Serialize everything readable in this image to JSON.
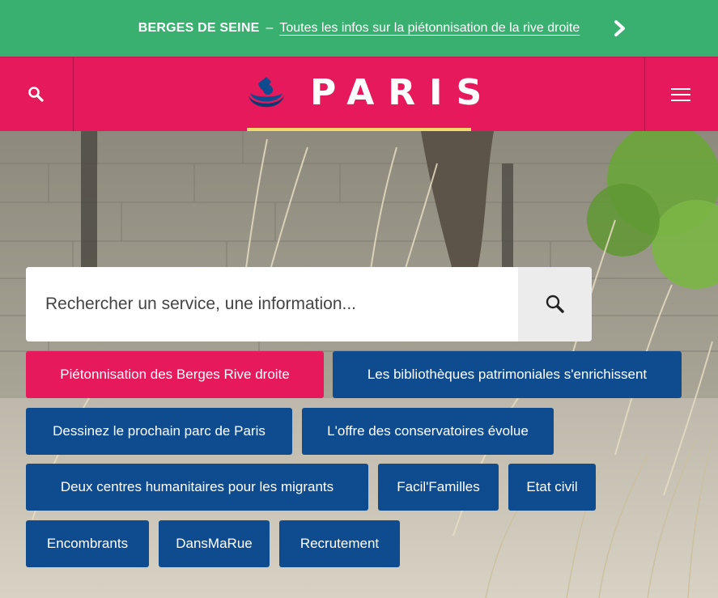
{
  "banner": {
    "title": "BERGES DE SEINE",
    "separator": "–",
    "link_text": "Toutes les infos sur la piétonnisation de la rive droite",
    "chevron_icon": "chevron-right-icon",
    "bg_color": "#3ab070"
  },
  "header": {
    "logo_text": "PARIS",
    "search_icon": "search-icon",
    "menu_icon": "hamburger-menu-icon",
    "bg_color": "#e5195b",
    "underline_color": "#f4d96a"
  },
  "search": {
    "placeholder": "Rechercher un service, une information...",
    "button_icon": "search-icon"
  },
  "quick_links": [
    {
      "label": "Piétonnisation des Berges Rive droite",
      "highlighted": true
    },
    {
      "label": "Les bibliothèques patrimoniales s'enrichissent",
      "highlighted": false
    },
    {
      "label": "Dessinez le prochain parc de Paris",
      "highlighted": false
    },
    {
      "label": "L'offre des conservatoires évolue",
      "highlighted": false
    },
    {
      "label": "Deux centres humanitaires pour les migrants",
      "highlighted": false
    },
    {
      "label": "Facil'Familles",
      "highlighted": false
    },
    {
      "label": "Etat civil",
      "highlighted": false
    },
    {
      "label": "Encombrants",
      "highlighted": false
    },
    {
      "label": "DansMaRue",
      "highlighted": false
    },
    {
      "label": "Recrutement",
      "highlighted": false
    }
  ],
  "colors": {
    "tag_blue": "#0f4c8f",
    "tag_pink": "#e5195b"
  }
}
